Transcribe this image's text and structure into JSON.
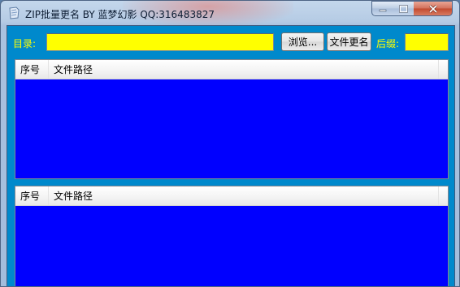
{
  "window": {
    "title": "ZIP批量更名 BY 蓝梦幻影 QQ:316483827"
  },
  "toolbar": {
    "dir_label": "目录:",
    "dir_value": "",
    "browse_label": "浏览...",
    "rename_label": "文件更名",
    "suffix_label": "后缀:",
    "suffix_value": ""
  },
  "list_top": {
    "columns": [
      "序号",
      "文件路径"
    ],
    "rows": []
  },
  "list_bottom": {
    "columns": [
      "序号",
      "文件路径"
    ],
    "rows": []
  },
  "colors": {
    "client_background": "#0089cc",
    "label_text": "#ffff00",
    "input_background": "#ffff00",
    "list_background": "#0000ff"
  }
}
